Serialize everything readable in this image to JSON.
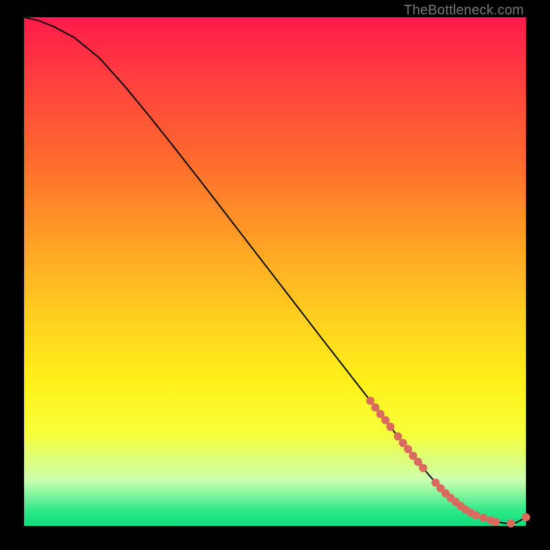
{
  "watermark": "TheBottleneck.com",
  "chart_data": {
    "type": "line",
    "title": "",
    "xlabel": "",
    "ylabel": "",
    "xlim": [
      0,
      100
    ],
    "ylim": [
      0,
      100
    ],
    "legend": false,
    "grid": false,
    "background_gradient": [
      "#ff1a4b",
      "#ff6a2e",
      "#ffd21f",
      "#fff11a",
      "#0edc7e"
    ],
    "series": [
      {
        "name": "bottleneck-curve",
        "x": [
          0,
          3,
          6,
          10,
          15,
          20,
          25,
          30,
          35,
          40,
          45,
          50,
          55,
          60,
          63,
          66,
          69,
          72,
          74,
          76,
          78,
          80,
          82,
          84,
          86,
          88,
          90,
          92,
          94,
          96,
          98,
          100
        ],
        "y": [
          100,
          99.3,
          98.1,
          96,
          92,
          86.5,
          80.5,
          74.3,
          68,
          61.6,
          55.2,
          48.8,
          42.4,
          36,
          32.2,
          28.4,
          24.6,
          20.8,
          18.2,
          15.7,
          13.2,
          10.8,
          8.5,
          6.4,
          4.7,
          3.2,
          2.1,
          1.3,
          0.8,
          0.5,
          0.6,
          1.7
        ]
      }
    ],
    "points": {
      "name": "highlighted-segment",
      "x": [
        69,
        70,
        71,
        72,
        73,
        74.5,
        75.5,
        76.5,
        77.5,
        78.5,
        79.5,
        82,
        83,
        84,
        85,
        86,
        87,
        88,
        89,
        90,
        91.5,
        93,
        94,
        97,
        100
      ],
      "y": [
        24.6,
        23.3,
        22.0,
        20.8,
        19.5,
        17.6,
        16.3,
        15.1,
        13.8,
        12.6,
        11.4,
        8.5,
        7.4,
        6.4,
        5.5,
        4.7,
        3.9,
        3.2,
        2.6,
        2.1,
        1.6,
        1.1,
        0.8,
        0.5,
        1.7
      ]
    }
  }
}
